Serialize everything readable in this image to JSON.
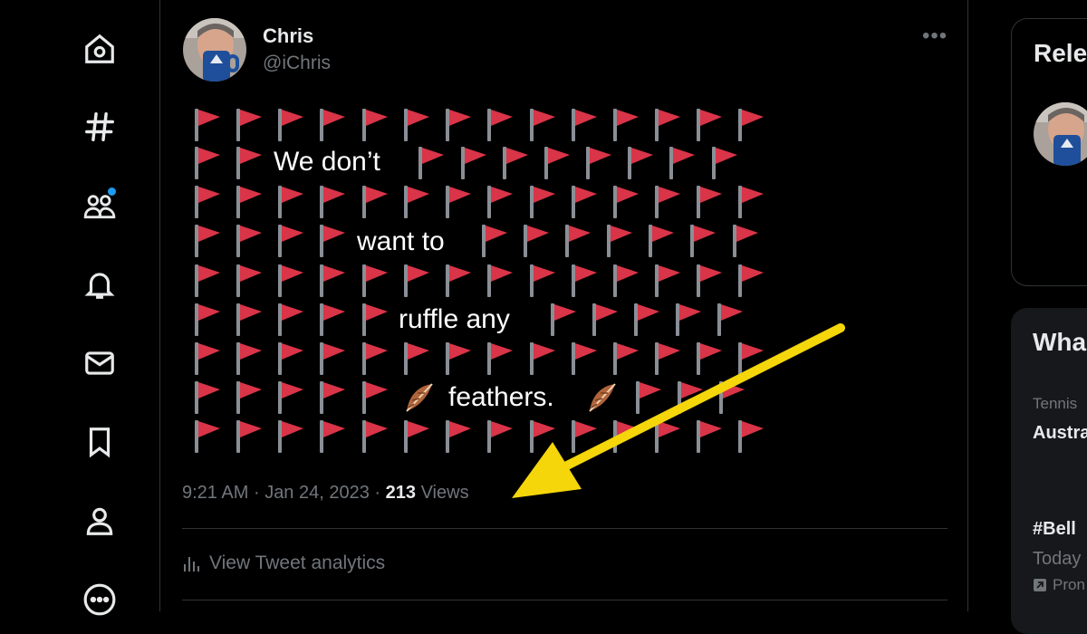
{
  "nav": {
    "items": [
      "home-icon",
      "explore-icon",
      "communities-icon",
      "notifications-icon",
      "messages-icon",
      "bookmarks-icon",
      "profile-icon",
      "more-icon"
    ],
    "notification_dot_color": "#1d9bf0"
  },
  "tweet": {
    "author_name": "Chris",
    "author_handle": "@iChris",
    "more_label": "•••",
    "text_lines": [
      "We don’t",
      "want to",
      "ruffle any",
      "feathers."
    ],
    "flag_color": "#d93448",
    "time": "9:21 AM",
    "date": "Jan 24, 2023",
    "separator": "·",
    "views_count": "213",
    "views_label": "Views",
    "analytics_label": "View Tweet analytics",
    "annotation_arrow_color": "#f5d60a"
  },
  "sidebar": {
    "related_title": "Rele",
    "happening_title": "Wha",
    "trends": [
      {
        "category": "Tennis",
        "title": "Austra"
      },
      {
        "title": "#Bell",
        "subtitle": "Today",
        "promo": "Pron"
      }
    ]
  }
}
